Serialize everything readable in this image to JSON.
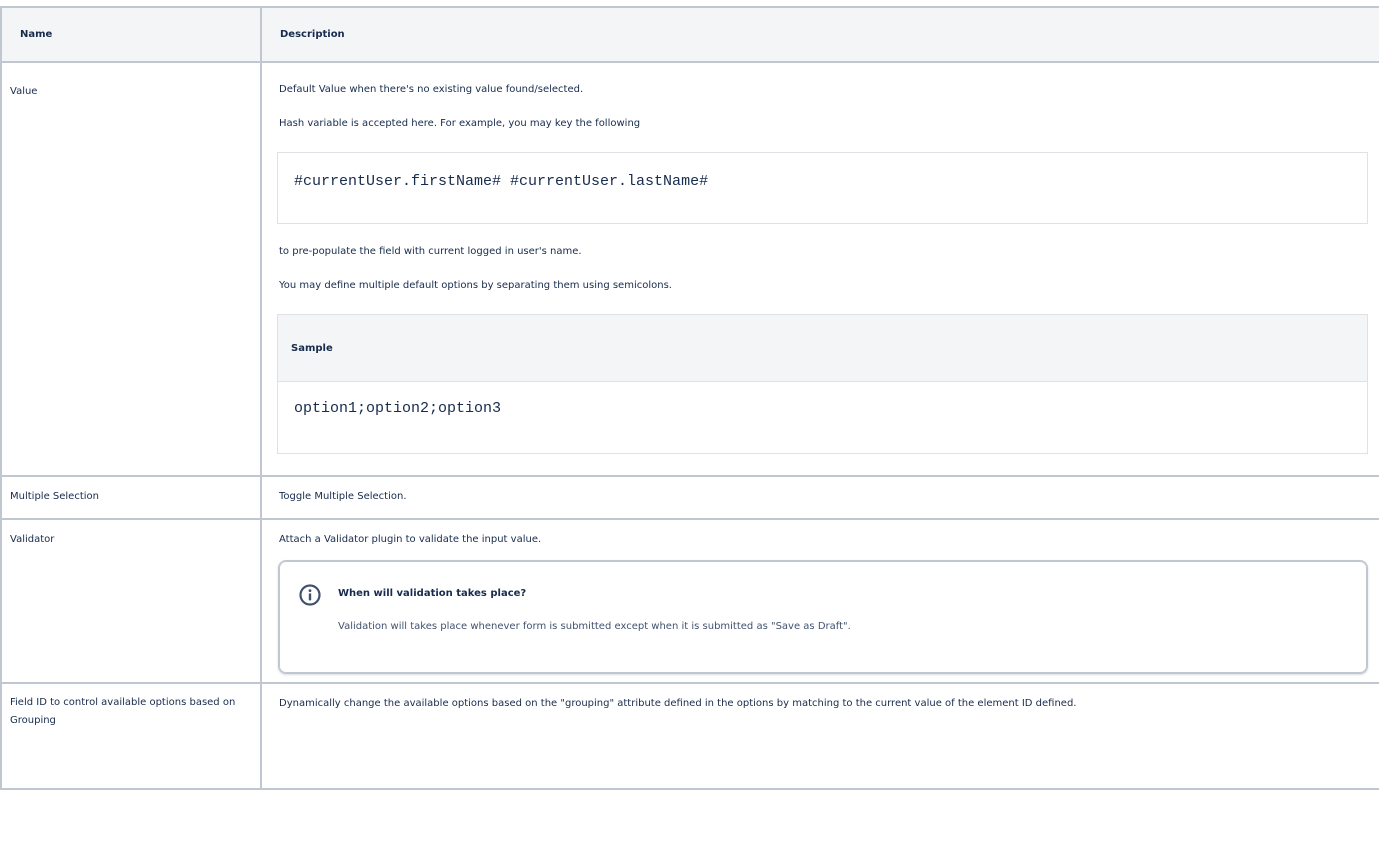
{
  "table": {
    "headers": {
      "name": "Name",
      "description": "Description"
    },
    "rows": [
      {
        "name": "Value",
        "description": {
          "intro": "Default Value when there's no existing value found/selected.",
          "hash_note": "Hash variable is accepted here. For example, you may key the following",
          "code": "#currentUser.firstName# #currentUser.lastName#",
          "after_code": "to pre-populate the field with current logged in user's name.",
          "multi_note": "You may define multiple default options by separating them using semicolons.",
          "sample": {
            "title": "Sample",
            "code": "option1;option2;option3"
          }
        }
      },
      {
        "name": "Multiple Selection",
        "description": {
          "text": "Toggle Multiple Selection."
        }
      },
      {
        "name": "Validator",
        "description": {
          "text": "Attach a Validator plugin to validate the input value.",
          "info_panel": {
            "icon": "info-icon",
            "title": "When will validation takes place?",
            "body": "Validation will takes place whenever form is submitted except when it is submitted as \"Save as Draft\"."
          }
        }
      },
      {
        "name": "Field ID to control available options based on Grouping",
        "description": {
          "text": "Dynamically change the available options based on the \"grouping\" attribute defined in the options by matching to the current value of the element ID defined."
        }
      }
    ]
  },
  "colors": {
    "border": "#c1c7d0",
    "header_bg": "#f4f5f7",
    "text": "#172b4d",
    "muted_text": "#42526e",
    "info_icon": "#42526e"
  }
}
